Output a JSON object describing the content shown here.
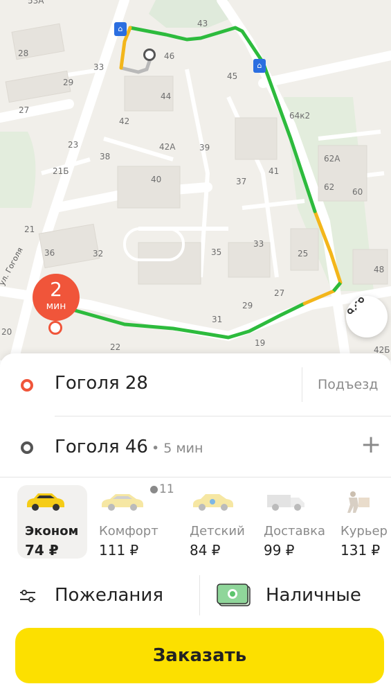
{
  "map": {
    "eta_value": "2",
    "eta_unit": "мин",
    "street_label": "ул. Гоголя",
    "building_labels": [
      "53А",
      "43",
      "46",
      "28",
      "33",
      "45",
      "29",
      "44",
      "27",
      "42",
      "64к2",
      "23",
      "21Б",
      "38",
      "42А",
      "39",
      "62А",
      "41",
      "40",
      "37",
      "62",
      "60",
      "21",
      "36",
      "32",
      "35",
      "33",
      "25",
      "48",
      "27",
      "29",
      "31",
      "20",
      "22",
      "19",
      "42Б"
    ]
  },
  "route": {
    "from": "Гоголя 28",
    "entrance_label": "Подъезд",
    "to": "Гоголя 46",
    "to_eta": "• 5 мин",
    "add_stop": "+"
  },
  "tariffs": [
    {
      "name": "Эконом",
      "price": "74 ₽",
      "selected": true
    },
    {
      "name": "Комфорт",
      "price": "111 ₽",
      "badge": "11"
    },
    {
      "name": "Детский",
      "price": "84 ₽"
    },
    {
      "name": "Доставка",
      "price": "99 ₽"
    },
    {
      "name": "Курьер",
      "price": "131 ₽"
    }
  ],
  "options": {
    "wishes_label": "Пожелания",
    "payment_label": "Наличные"
  },
  "order_button": "Заказать",
  "colors": {
    "accent": "#fce000",
    "origin": "#f0553a",
    "route_green": "#2dbb3d",
    "route_yellow": "#f3b61b"
  }
}
